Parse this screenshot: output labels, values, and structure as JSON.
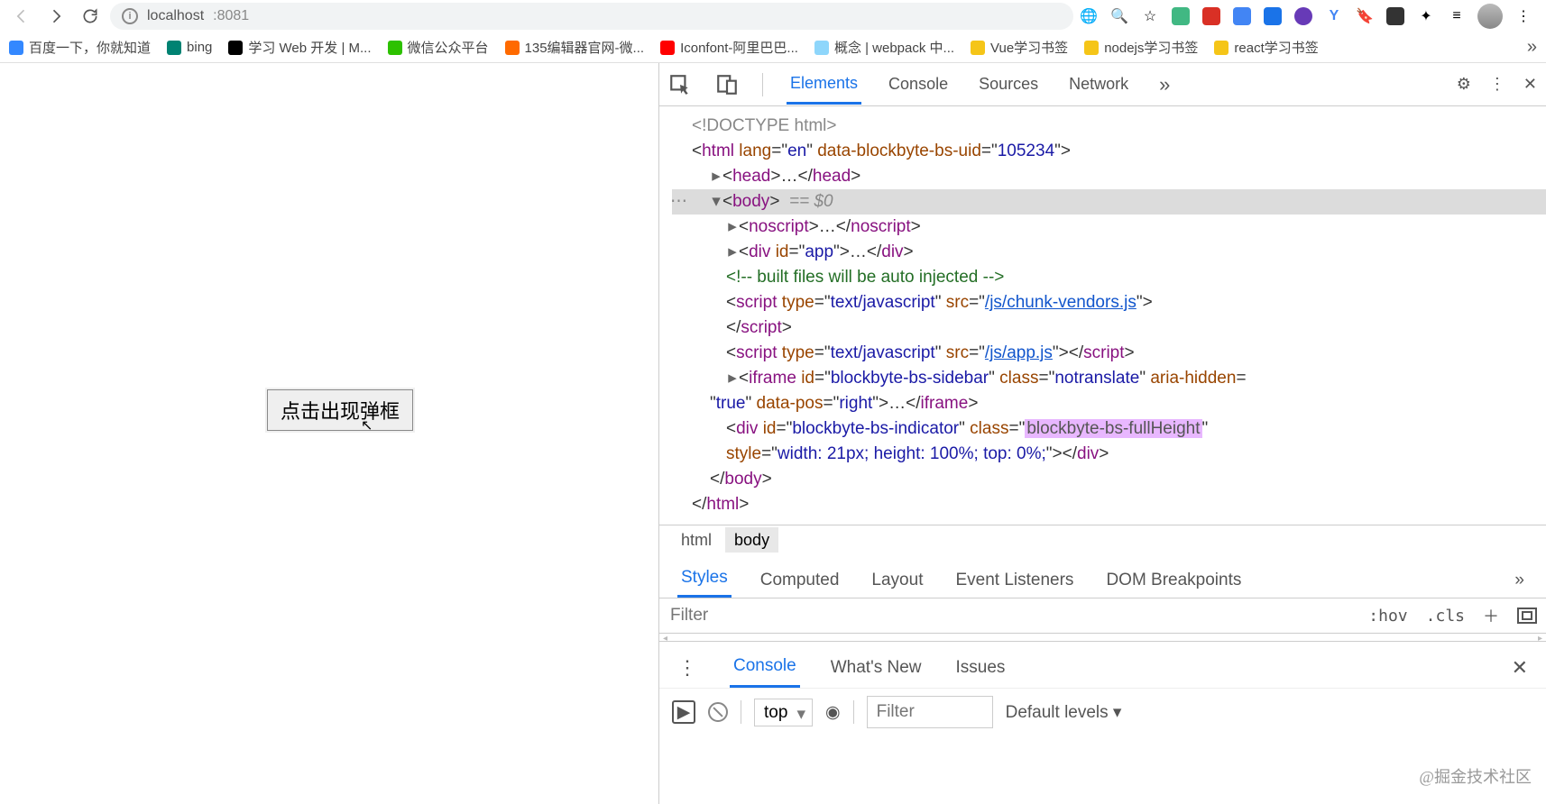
{
  "toolbar": {
    "url_host": "localhost",
    "url_port": ":8081"
  },
  "bookmarks": [
    {
      "label": "百度一下，你就知道",
      "color": "#3388ff"
    },
    {
      "label": "bing",
      "color": "#008272"
    },
    {
      "label": "学习 Web 开发 | M...",
      "color": "#000000"
    },
    {
      "label": "微信公众平台",
      "color": "#2dc100"
    },
    {
      "label": "135编辑器官网-微...",
      "color": "#ff6a00"
    },
    {
      "label": "Iconfont-阿里巴巴...",
      "color": "#ff0000"
    },
    {
      "label": "概念 | webpack 中...",
      "color": "#8ed6fb"
    },
    {
      "label": "Vue学习书签",
      "color": "#f5c518"
    },
    {
      "label": "nodejs学习书签",
      "color": "#f5c518"
    },
    {
      "label": "react学习书签",
      "color": "#f5c518"
    }
  ],
  "page": {
    "button_text": "点击出现弹框"
  },
  "devtools": {
    "tabs": [
      "Elements",
      "Console",
      "Sources",
      "Network"
    ],
    "active_tab": "Elements",
    "dom": {
      "doctype": "<!DOCTYPE html>",
      "html_open": {
        "lang": "en",
        "uid_attr": "data-blockbyte-bs-uid",
        "uid_val": "105234"
      },
      "head": "head",
      "body_eq": "== $0",
      "noscript": "noscript",
      "div_app_id": "app",
      "comment": " built files will be auto injected ",
      "script1": {
        "type": "text/javascript",
        "src": "/js/chunk-vendors.js"
      },
      "script2": {
        "type": "text/javascript",
        "src": "/js/app.js"
      },
      "iframe": {
        "id": "blockbyte-bs-sidebar",
        "class": "notranslate",
        "aria": "aria-hidden=",
        "aria_val": "true",
        "pos": "right"
      },
      "indicator": {
        "id": "blockbyte-bs-indicator",
        "class_hl": "blockbyte-bs-fullHeight",
        "style": "width: 21px; height: 100%; top: 0%;"
      }
    },
    "crumbs": [
      "html",
      "body"
    ],
    "style_tabs": [
      "Styles",
      "Computed",
      "Layout",
      "Event Listeners",
      "DOM Breakpoints"
    ],
    "active_style_tab": "Styles",
    "filter_placeholder": "Filter",
    "hov": ":hov",
    "cls": ".cls",
    "drawer_tabs": [
      "Console",
      "What's New",
      "Issues"
    ],
    "active_drawer_tab": "Console",
    "console": {
      "context": "top",
      "filter_placeholder": "Filter",
      "levels": "Default levels"
    }
  },
  "watermark": "@掘金技术社区"
}
